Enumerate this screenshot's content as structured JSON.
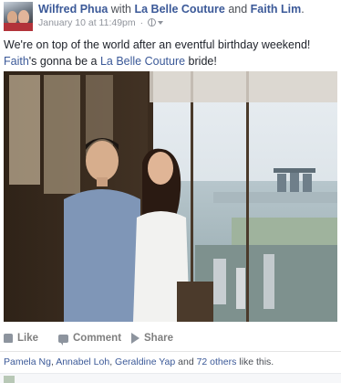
{
  "post": {
    "author": "Wilfred Phua",
    "with_word": "with",
    "tagged_1": "La Belle Couture",
    "and_word": "and",
    "tagged_2": "Faith Lim",
    "period": ".",
    "timestamp": "January 10 at 11:49pm",
    "separator": "·",
    "privacy_icon": "globe-icon",
    "text_part1": "We're on top of the world after an eventful birthday weekend! ",
    "text_link1": "Faith",
    "text_part2": "'s gonna be a ",
    "text_link2": "La Belle Couture",
    "text_part3": " bride!"
  },
  "actions": {
    "like": "Like",
    "comment": "Comment",
    "share": "Share"
  },
  "likes": {
    "name1": "Pamela Ng",
    "comma1": ", ",
    "name2": "Annabel Loh",
    "comma2": ", ",
    "name3": "Geraldine Yap",
    "and_word": " and ",
    "others": "72 others",
    "suffix": " like this."
  },
  "colors": {
    "link": "#3b5998",
    "meta": "#90949c",
    "action": "#7f7f7f"
  }
}
